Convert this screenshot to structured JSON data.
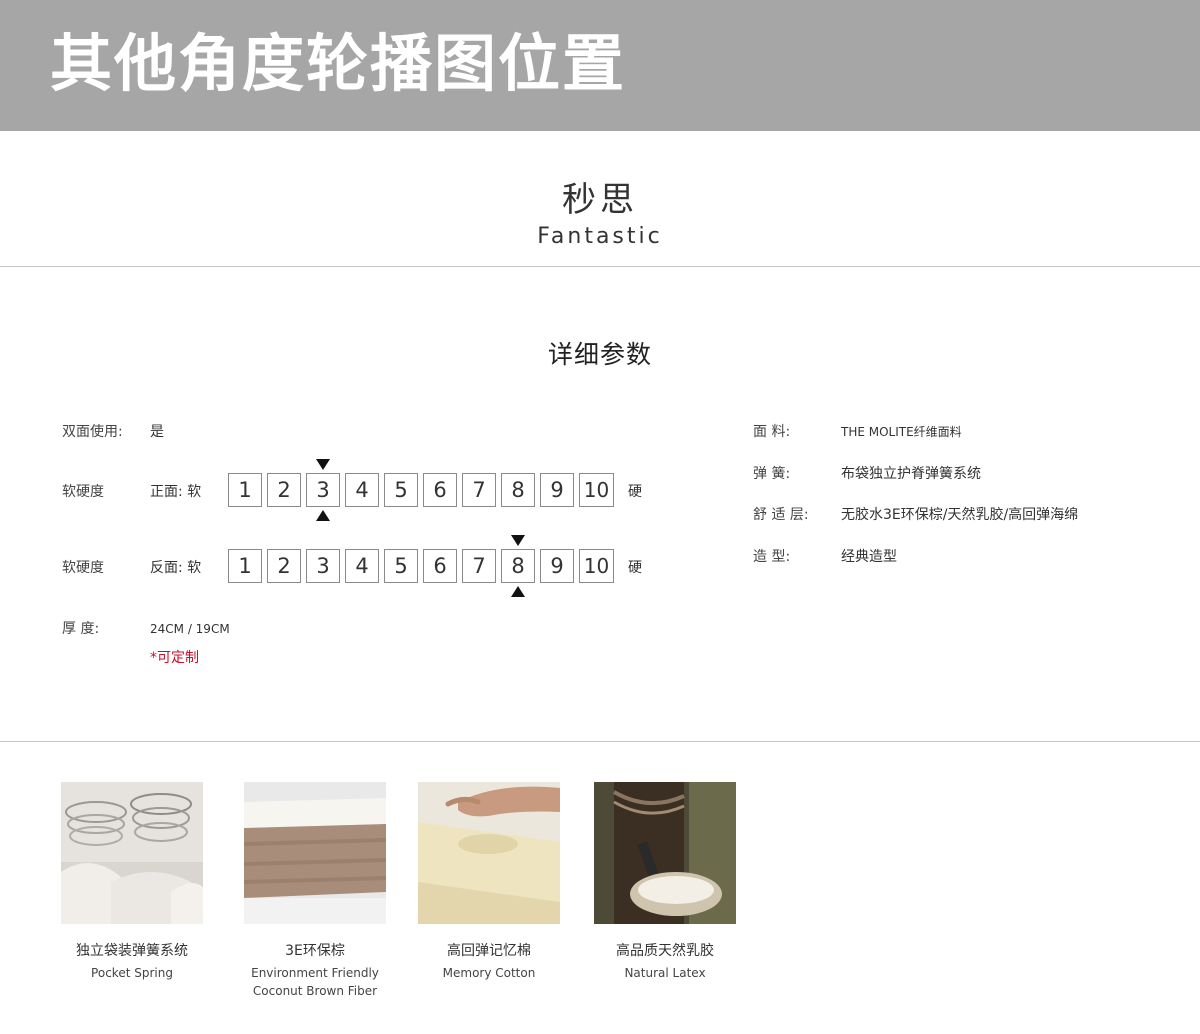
{
  "banner": {
    "title": "其他角度轮播图位置"
  },
  "brand": {
    "name_cn": "秒思",
    "name_en": "Fantastic"
  },
  "section": {
    "title": "详细参数"
  },
  "params_left": {
    "double_sided_label": "双面使用:",
    "double_sided_value": "是",
    "hardness_label_front": "软硬度",
    "front_side_label": "正面: 软",
    "hardness_label_back": "软硬度",
    "back_side_label": "反面: 软",
    "hard_label": "硬",
    "scale": [
      "1",
      "2",
      "3",
      "4",
      "5",
      "6",
      "7",
      "8",
      "9",
      "10"
    ],
    "front_selected": 3,
    "back_selected": 8,
    "thickness_label": "厚    度:",
    "thickness_value": "24CM / 19CM",
    "custom_note": "*可定制"
  },
  "params_right": {
    "fabric_label": "面    料:",
    "fabric_value": "THE MOLITE纤维面料",
    "spring_label": "弹    簧:",
    "spring_value": "布袋独立护脊弹簧系统",
    "comfort_label": "舒 适 层:",
    "comfort_value": "无胶水3E环保棕/天然乳胶/高回弹海绵",
    "style_label": "造    型:",
    "style_value": "经典造型"
  },
  "features": [
    {
      "name_cn": "独立袋装弹簧系统",
      "name_en": "Pocket Spring",
      "name_en2": ""
    },
    {
      "name_cn": "3E环保棕",
      "name_en": "Environment Friendly",
      "name_en2": "Coconut Brown Fiber"
    },
    {
      "name_cn": "高回弹记忆棉",
      "name_en": "Memory Cotton",
      "name_en2": ""
    },
    {
      "name_cn": "高品质天然乳胶",
      "name_en": "Natural Latex",
      "name_en2": ""
    }
  ]
}
